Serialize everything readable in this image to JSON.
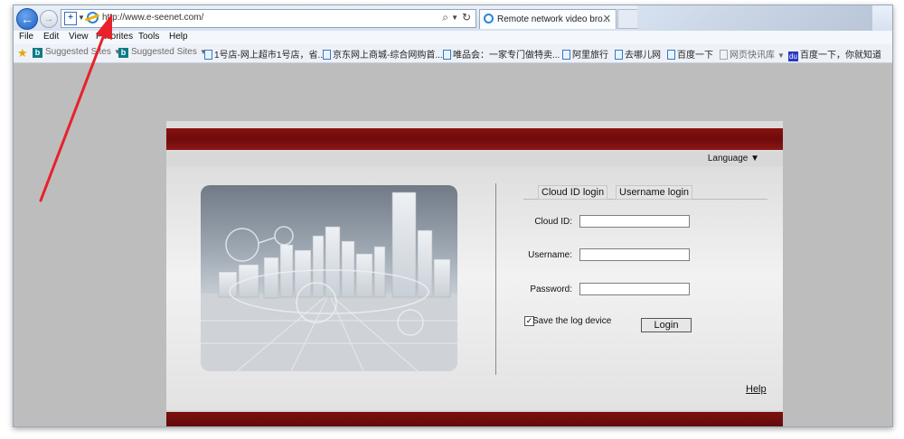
{
  "browser": {
    "url": "http://www.e-seenet.com/",
    "tab_title": "Remote network video bro...",
    "tab_close": "✕",
    "search_glyph": "⌕",
    "refresh_glyph": "↻"
  },
  "menu": [
    "File",
    "Edit",
    "View",
    "Favorites",
    "Tools",
    "Help"
  ],
  "favorites": [
    {
      "label": "Suggested Sites",
      "icon": "bing-icon",
      "muted": true,
      "dropdown": true
    },
    {
      "label": "Suggested Sites",
      "icon": "bing-icon",
      "muted": true,
      "dropdown": true
    },
    {
      "label": "1号店-网上超市1号店，省...",
      "icon": "page-icon"
    },
    {
      "label": "京东网上商城-综合网购首...",
      "icon": "page-icon"
    },
    {
      "label": "唯品会：一家专门做特卖...",
      "icon": "page-icon"
    },
    {
      "label": "阿里旅行",
      "icon": "page-icon"
    },
    {
      "label": "去哪儿网",
      "icon": "page-icon"
    },
    {
      "label": "百度一下",
      "icon": "page-icon"
    },
    {
      "label": "网页快讯库",
      "icon": "page-icon",
      "muted": true,
      "dropdown": true
    },
    {
      "label": "百度一下，你就知道",
      "icon": "baidu-icon"
    }
  ],
  "login": {
    "language_label": "Language ▼",
    "tab_cloud": "Cloud ID login",
    "tab_username": "Username login",
    "cloud_id_label": "Cloud ID:",
    "username_label": "Username:",
    "password_label": "Password:",
    "cloud_id_value": "",
    "username_value": "",
    "password_value": "",
    "save_device_label": "Save the log device",
    "save_device_checked": true,
    "check_glyph": "✓",
    "login_button": "Login",
    "help_link": "Help"
  },
  "colors": {
    "banner_red": "#7a0e0e",
    "annotation_arrow": "#e8212b"
  }
}
